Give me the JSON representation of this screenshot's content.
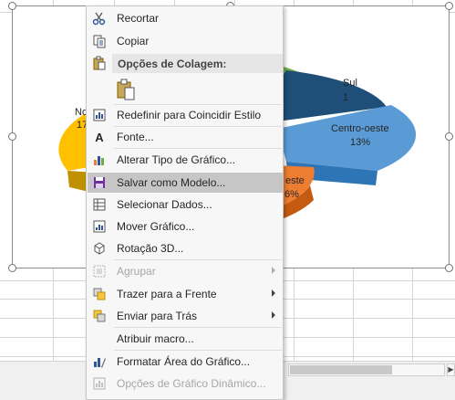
{
  "chart": {
    "labels": {
      "sul": "Sul",
      "sul_pct": "1",
      "norte_prefix": "No",
      "norte_pct": "17",
      "centro_oeste": "Centro-oeste",
      "centro_oeste_pct": "13%",
      "sudeste_suffix": "este",
      "sudeste_pct": "6%"
    },
    "colors": {
      "norte": "#ffc000",
      "sul": "#1f4e79",
      "centro_oeste": "#5b9bd5",
      "sudeste": "#ed7d31",
      "nordeste": "#70ad47"
    }
  },
  "menu": {
    "items": [
      {
        "label": "Recortar",
        "icon": "scissors-icon"
      },
      {
        "label": "Copiar",
        "icon": "copy-icon"
      },
      {
        "label": "Opções de Colagem:",
        "icon": "paste-icon"
      },
      {
        "label": "",
        "icon": "paste-option-icon"
      },
      {
        "label": "Redefinir para Coincidir Estilo",
        "icon": "reset-style-icon"
      },
      {
        "label": "Fonte...",
        "icon": "font-icon"
      },
      {
        "label": "Alterar Tipo de Gráfico...",
        "icon": "chart-type-icon"
      },
      {
        "label": "Salvar como Modelo...",
        "icon": "save-template-icon"
      },
      {
        "label": "Selecionar Dados...",
        "icon": "select-data-icon"
      },
      {
        "label": "Mover Gráfico...",
        "icon": "move-chart-icon"
      },
      {
        "label": "Rotação 3D...",
        "icon": "rotation-3d-icon"
      },
      {
        "label": "Agrupar",
        "icon": "group-icon"
      },
      {
        "label": "Trazer para a Frente",
        "icon": "bring-forward-icon"
      },
      {
        "label": "Enviar para Trás",
        "icon": "send-backward-icon"
      },
      {
        "label": "Atribuir macro...",
        "icon": ""
      },
      {
        "label": "Formatar Área do Gráfico...",
        "icon": "format-area-icon"
      },
      {
        "label": "Opções de Gráfico Dinâmico...",
        "icon": "pivot-options-icon"
      }
    ]
  }
}
